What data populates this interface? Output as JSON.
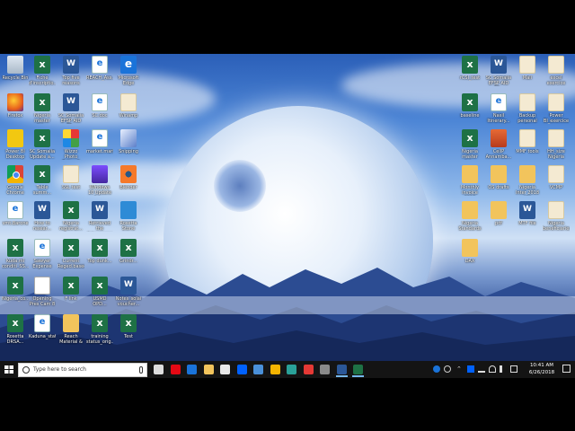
{
  "desktop": {
    "icons": [
      {
        "label": "Recycle Bin",
        "type": "recycle"
      },
      {
        "label": "Fiche d'inscriptio...",
        "type": "excel"
      },
      {
        "label": "Top five reasons",
        "type": "word"
      },
      {
        "label": "REACH_Ass...",
        "type": "pdf"
      },
      {
        "label": "Microsoft Edge",
        "type": "edge"
      },
      {
        "label": "Firefox",
        "type": "firefox"
      },
      {
        "label": "Nigeria master list...",
        "type": "excel"
      },
      {
        "label": "SC Somalia EFSP AID FF...",
        "type": "word"
      },
      {
        "label": "SC.doc",
        "type": "pdf"
      },
      {
        "label": "Winamp",
        "type": "file"
      },
      {
        "label": "Power BI Desktop",
        "type": "powerbi"
      },
      {
        "label": "SC Somalia Update a...",
        "type": "excel"
      },
      {
        "label": "Wizzo Photo Editor 8",
        "type": "photo"
      },
      {
        "label": "market.market...",
        "type": "pdf"
      },
      {
        "label": "Snipping",
        "type": "shot"
      },
      {
        "label": "Google Chrome",
        "type": "chrome"
      },
      {
        "label": "Table summ...",
        "type": "excel"
      },
      {
        "label": "SSL test",
        "type": "file"
      },
      {
        "label": "Windows 10 Update Ass...",
        "type": "winrar"
      },
      {
        "label": "Blender",
        "type": "blender"
      },
      {
        "label": "vmt.Barone",
        "type": "pdf"
      },
      {
        "label": "How to resear...",
        "type": "word"
      },
      {
        "label": "Nigeria registrat...",
        "type": "excel"
      },
      {
        "label": "Retrieved the data.reason...",
        "type": "word"
      },
      {
        "label": "Rosetta Stone",
        "type": "arrow"
      },
      {
        "label": "Kuda.ml conditi_SS...",
        "type": "excel"
      },
      {
        "label": "Sawyer Expense L...",
        "type": "pdf"
      },
      {
        "label": "Current Reged.based...",
        "type": "excel"
      },
      {
        "label": "Top dunk...",
        "type": "excel"
      },
      {
        "label": "Grindr...",
        "type": "excel"
      },
      {
        "label": "Nigeria_co...",
        "type": "excel"
      },
      {
        "label": "Opening Pres Cam 8",
        "type": "pres"
      },
      {
        "label": "F link",
        "type": "excel"
      },
      {
        "label": "USMD OPD...",
        "type": "excel"
      },
      {
        "label": "Notes_solai voucher...",
        "type": "word"
      },
      {
        "label": "Rosetta DRSA...",
        "type": "excel"
      },
      {
        "label": "Kaduna_state...",
        "type": "pdf"
      },
      {
        "label": "Reach Material & apps",
        "type": "folder"
      },
      {
        "label": "training status_orig...",
        "type": "excel"
      },
      {
        "label": "Test",
        "type": "excel"
      },
      {
        "label": "rCSI_test",
        "type": "excel"
      },
      {
        "label": "SC Somalia EFSP AID FF...",
        "type": "word"
      },
      {
        "label": "Mali",
        "type": "file"
      },
      {
        "label": "excel exercice",
        "type": "file"
      },
      {
        "label": "baseline",
        "type": "excel"
      },
      {
        "label": "Nasil Itinerary...",
        "type": "pdf"
      },
      {
        "label": "Backup personal doc",
        "type": "file"
      },
      {
        "label": "Power BI_exercice",
        "type": "file"
      },
      {
        "label": "Nigeria master list...",
        "type": "excel"
      },
      {
        "label": "CellP Annamba...",
        "type": "gimp"
      },
      {
        "label": "MMF tools",
        "type": "file"
      },
      {
        "label": "HH_size Nigeria",
        "type": "file"
      },
      {
        "label": "Monthly invoice 2018",
        "type": "folder"
      },
      {
        "label": "OS drafts",
        "type": "folder"
      },
      {
        "label": "Nigeria Inter 2018 HH",
        "type": "folder"
      },
      {
        "label": "VCMP",
        "type": "file"
      },
      {
        "label": "Nigeria Standards",
        "type": "folder"
      },
      {
        "label": "pdf",
        "type": "folder"
      },
      {
        "label": "MTF file",
        "type": "word"
      },
      {
        "label": "Nigeria beneficiaries1918",
        "type": "file"
      },
      {
        "label": "DAX",
        "type": "folder"
      }
    ]
  },
  "taskbar": {
    "search_placeholder": "Type here to search",
    "apps": [
      {
        "name": "task-view",
        "color": "#dddddd"
      },
      {
        "name": "netflix",
        "color": "#e50914"
      },
      {
        "name": "edge",
        "color": "#1a73d9"
      },
      {
        "name": "file-explorer",
        "color": "#f2c45c"
      },
      {
        "name": "store",
        "color": "#e8e8e8"
      },
      {
        "name": "dropbox",
        "color": "#0061fe"
      },
      {
        "name": "photos",
        "color": "#4a90d9"
      },
      {
        "name": "chrome",
        "color": "#f4b400"
      },
      {
        "name": "terminal",
        "color": "#2aa198"
      },
      {
        "name": "paint",
        "color": "#e53935"
      },
      {
        "name": "calculator",
        "color": "#8a8a8a"
      },
      {
        "name": "word",
        "color": "#2b5797"
      },
      {
        "name": "excel",
        "color": "#1e7145"
      }
    ],
    "time": "10:41 AM",
    "date": "6/26/2018"
  },
  "colors": {
    "taskbar": "#141414",
    "accent": "#76b9ed"
  }
}
